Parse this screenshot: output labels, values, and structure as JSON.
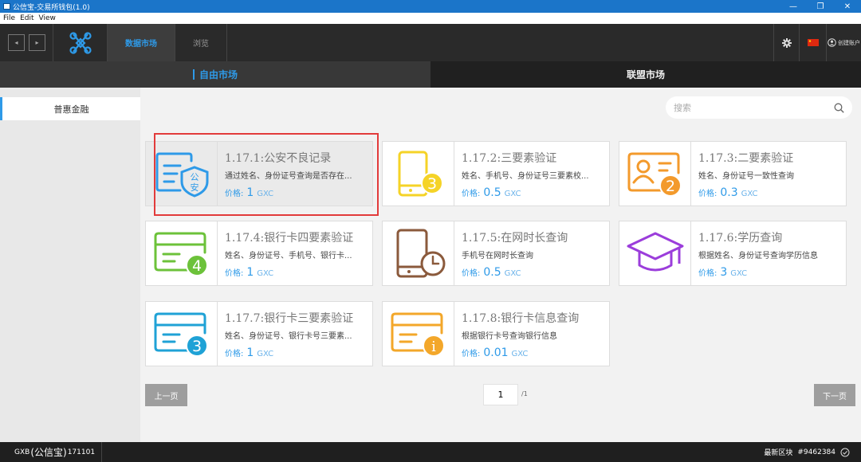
{
  "window": {
    "title": "公信宝-交易所钱包(1.0)",
    "minimize": "—",
    "restore": "❐",
    "close": "✕"
  },
  "menu": [
    "File",
    "Edit",
    "View"
  ],
  "nav": {
    "back": "◂",
    "forward": "▸",
    "tabs": [
      {
        "label": "数据市场",
        "active": true
      },
      {
        "label": "浏览",
        "active": false
      }
    ],
    "account_label": "创建账户"
  },
  "market_tabs": [
    {
      "label": "自由市场",
      "active": true
    },
    {
      "label": "联盟市场",
      "active": false
    }
  ],
  "sidebar": {
    "items": [
      {
        "label": "普惠金融",
        "active": true
      }
    ]
  },
  "search": {
    "placeholder": "搜索"
  },
  "price_label": "价格:",
  "cards": [
    {
      "title": "1.17.1:公安不良记录",
      "desc": "通过姓名、身份证号查询是否存在...",
      "price": "1",
      "unit": "GXC",
      "icon": "police-badge-icon",
      "color": "#2e9ae8"
    },
    {
      "title": "1.17.2:三要素验证",
      "desc": "姓名、手机号、身份证号三要素校...",
      "price": "0.5",
      "unit": "GXC",
      "icon": "phone-three-icon",
      "color": "#f5d327",
      "badge": "3"
    },
    {
      "title": "1.17.3:二要素验证",
      "desc": "姓名、身份证号一致性查询",
      "price": "0.3",
      "unit": "GXC",
      "icon": "id-card-two-icon",
      "color": "#f39a2c",
      "badge": "2"
    },
    {
      "title": "1.17.4:银行卡四要素验证",
      "desc": "姓名、身份证号、手机号、银行卡...",
      "price": "1",
      "unit": "GXC",
      "icon": "bank-card-four-icon",
      "color": "#6cc23a",
      "badge": "4"
    },
    {
      "title": "1.17.5:在网时长查询",
      "desc": "手机号在网时长查询",
      "price": "0.5",
      "unit": "GXC",
      "icon": "phone-clock-icon",
      "color": "#8b5a3c"
    },
    {
      "title": "1.17.6:学历查询",
      "desc": "根据姓名、身份证号查询学历信息",
      "price": "3",
      "unit": "GXC",
      "icon": "graduation-cap-icon",
      "color": "#9b3ddb"
    },
    {
      "title": "1.17.7:银行卡三要素验证",
      "desc": "姓名、身份证号、银行卡号三要素...",
      "price": "1",
      "unit": "GXC",
      "icon": "bank-card-three-icon",
      "color": "#1fa2d6",
      "badge": "3"
    },
    {
      "title": "1.17.8:银行卡信息查询",
      "desc": "根据银行卡号查询银行信息",
      "price": "0.01",
      "unit": "GXC",
      "icon": "bank-card-info-icon",
      "color": "#f3a72a",
      "badge": "i"
    }
  ],
  "pagination": {
    "prev": "上一页",
    "next": "下一页",
    "current": "1",
    "total": "/1"
  },
  "status": {
    "prefix": "GXB",
    "name": "(公信宝)",
    "id": "171101",
    "block_label": "最新区块",
    "block_num": "#9462384"
  }
}
